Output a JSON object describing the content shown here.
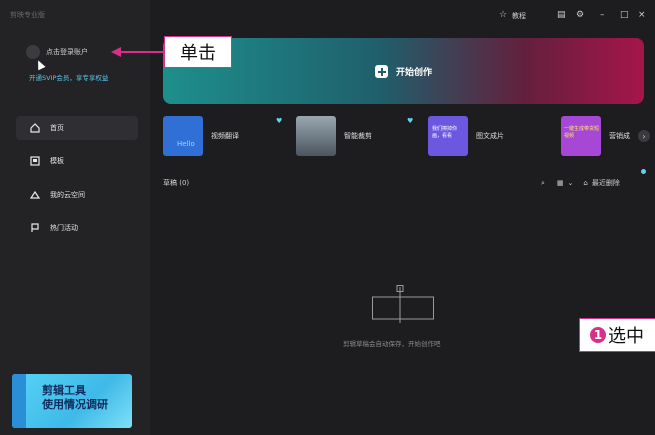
{
  "app": {
    "logo_text": "剪映专业版"
  },
  "sidebar": {
    "login_label": "点击登录账户",
    "promo_text": "开通SVIP会员，享专享权益",
    "nav": [
      {
        "label": "首页",
        "icon": "home-icon"
      },
      {
        "label": "模板",
        "icon": "template-icon"
      },
      {
        "label": "我的云空间",
        "icon": "cloud-icon"
      },
      {
        "label": "热门活动",
        "icon": "flag-icon"
      }
    ],
    "survey_line1": "剪辑工具",
    "survey_line2": "使用情况调研"
  },
  "titlebar": {
    "tutorial_label": "教程"
  },
  "main": {
    "banner_label": "开始创作",
    "tools": [
      {
        "label": "视频翻译",
        "thumb_color": "#2f6fd6",
        "thumb_text": "Hello"
      },
      {
        "label": "智能裁剪",
        "thumb_color": "#5a6c7a"
      },
      {
        "label": "图文成片",
        "thumb_color": "#6b57e0",
        "thumb_text": "我们擦掉你画，看看"
      },
      {
        "label": "营销成",
        "thumb_color": "#a647d6",
        "thumb_text": "一键生成带货短视频"
      }
    ],
    "drafts_label": "草稿 (0)",
    "recycle_label": "最近删除",
    "empty_text": "剪辑草稿会自动保存，开始创作吧"
  },
  "annotations": {
    "click_label": "单击",
    "step_number": "1",
    "step_label": "选中"
  },
  "colors": {
    "accent": "#d8308a",
    "promo": "#58c6e6"
  }
}
